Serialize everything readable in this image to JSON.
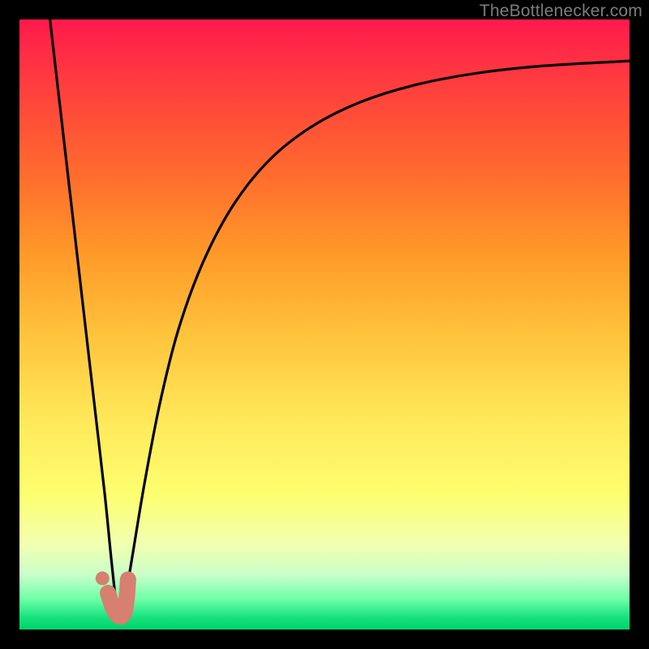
{
  "watermark": "TheBottlenecker.com",
  "colors": {
    "frame": "#000000",
    "curve": "#000000",
    "marker_fill": "#d77f70",
    "marker_stroke": "#d77f70",
    "gradient_top": "#ff1a4d",
    "gradient_bottom": "#00d36a"
  },
  "chart_data": {
    "type": "line",
    "title": "",
    "xlabel": "",
    "ylabel": "",
    "xlim": [
      0,
      100
    ],
    "ylim": [
      0,
      100
    ],
    "grid": false,
    "legend": false,
    "note": "Axes are unlabeled; values are estimated proportions of the plot area (0–100). The two black curves form a V meeting near the bottom; a short salmon J-shaped marker sits at the trough.",
    "series": [
      {
        "name": "left-branch",
        "x": [
          5.0,
          6.5,
          8.0,
          9.5,
          11.0,
          12.5,
          14.0,
          15.0,
          15.8
        ],
        "y": [
          100.0,
          87.0,
          74.0,
          61.0,
          48.0,
          35.0,
          22.0,
          12.0,
          4.5
        ]
      },
      {
        "name": "right-branch",
        "x": [
          17.0,
          18.5,
          20.5,
          23.0,
          26.0,
          30.0,
          35.0,
          41.0,
          48.0,
          56.0,
          65.0,
          75.0,
          86.0,
          100.0
        ],
        "y": [
          3.0,
          12.0,
          24.0,
          37.0,
          49.0,
          60.0,
          69.5,
          77.0,
          82.5,
          86.5,
          89.3,
          91.2,
          92.4,
          93.2
        ]
      },
      {
        "name": "marker-j",
        "x": [
          14.5,
          15.3,
          16.0,
          16.8,
          17.3,
          17.6,
          17.8
        ],
        "y": [
          6.0,
          3.6,
          2.4,
          2.2,
          3.2,
          5.4,
          8.2
        ]
      }
    ],
    "points": [
      {
        "name": "dot",
        "x": 13.6,
        "y": 8.4
      }
    ]
  }
}
